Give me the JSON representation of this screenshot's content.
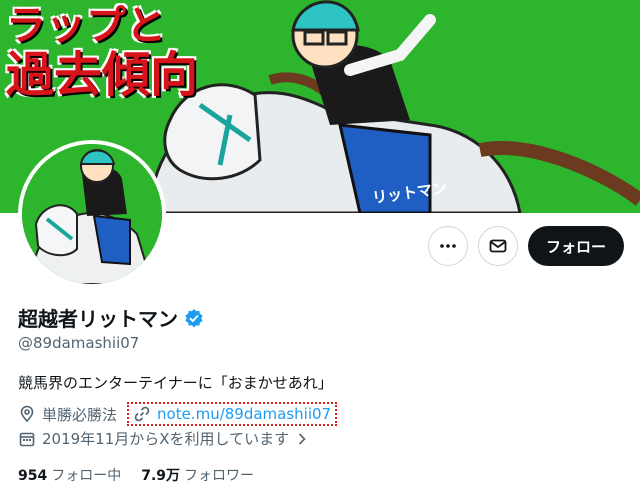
{
  "banner": {
    "title_line1": "ラップと",
    "title_line2": "過去傾向",
    "saddle_text": "リットマン",
    "bg_color": "#2db52d"
  },
  "actions": {
    "more_icon": "more-horizontal-icon",
    "message_icon": "envelope-icon",
    "follow_label": "フォロー"
  },
  "profile": {
    "display_name": "超越者リットマン",
    "verified_icon": "verified-badge-icon",
    "handle": "@89damashii07",
    "bio": "競馬界のエンターテイナーに「おまかせあれ」",
    "location": "単勝必勝法",
    "link": "note.mu/89damashii07",
    "joined": "2019年11月からXを利用しています",
    "accent_color": "#1d9bf0"
  },
  "stats": {
    "following_count": "954",
    "following_label": "フォロー中",
    "followers_count": "7.9万",
    "followers_label": "フォロワー"
  }
}
